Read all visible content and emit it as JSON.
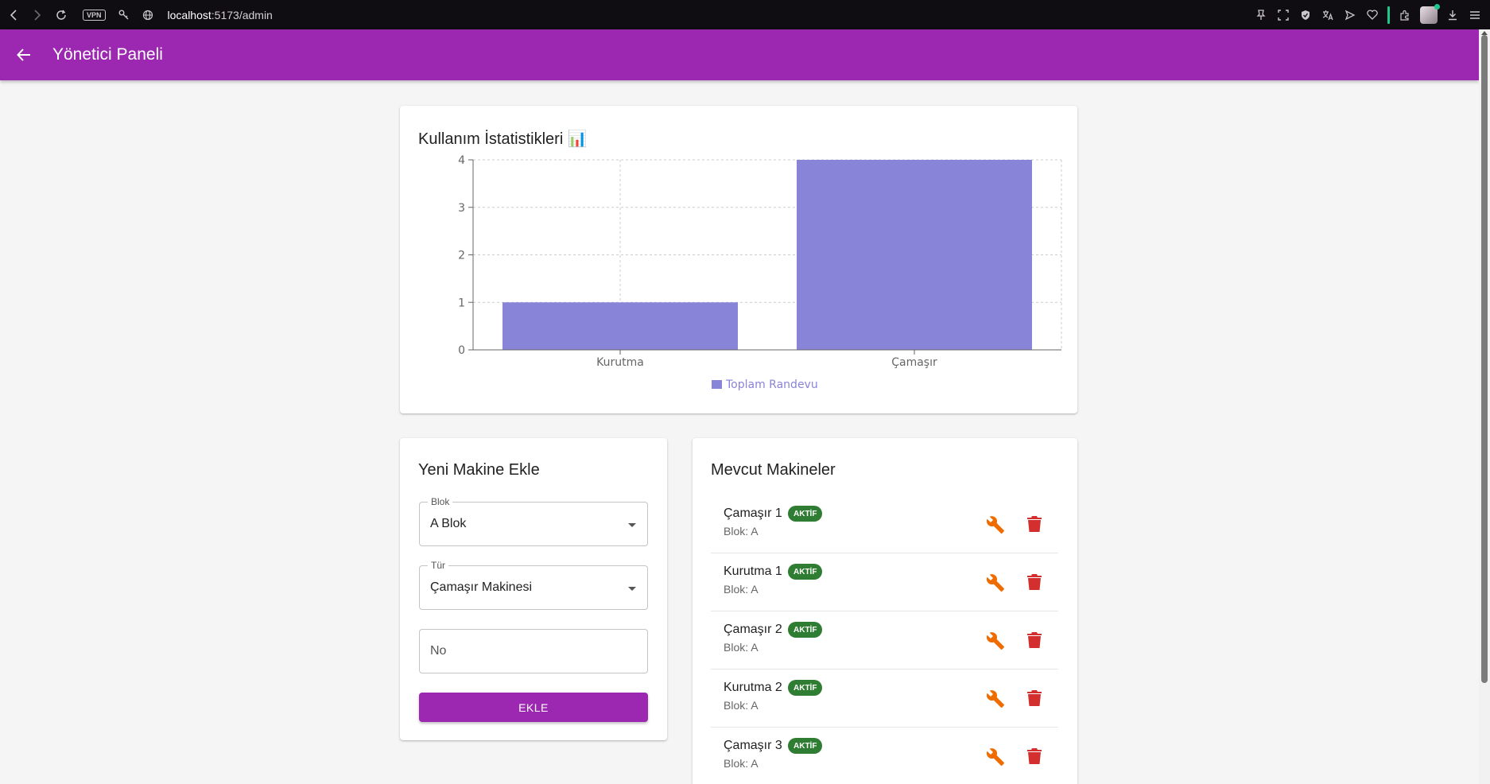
{
  "browser": {
    "url_host": "localhost",
    "url_path": ":5173/admin",
    "vpn": "VPN"
  },
  "app_bar": {
    "title": "Yönetici Paneli"
  },
  "stats": {
    "title": "Kullanım İstatistikleri 📊",
    "chart_data": {
      "type": "bar",
      "categories": [
        "Kurutma",
        "Çamaşır"
      ],
      "series": [
        {
          "name": "Toplam Randevu",
          "values": [
            1,
            4
          ],
          "color": "#8884d8"
        }
      ],
      "ylim": [
        0,
        4
      ],
      "yticks": [
        0,
        1,
        2,
        3,
        4
      ],
      "grid": true,
      "legend": "bottom"
    }
  },
  "form": {
    "title": "Yeni Makine Ekle",
    "block_label": "Blok",
    "block_value": "A Blok",
    "type_label": "Tür",
    "type_value": "Çamaşır Makinesi",
    "no_placeholder": "No",
    "submit_label": "EKLE"
  },
  "machines": {
    "title": "Mevcut Makineler",
    "items": [
      {
        "name": "Çamaşır 1",
        "status": "AKTİF",
        "block": "Blok: A"
      },
      {
        "name": "Kurutma 1",
        "status": "AKTİF",
        "block": "Blok: A"
      },
      {
        "name": "Çamaşır 2",
        "status": "AKTİF",
        "block": "Blok: A"
      },
      {
        "name": "Kurutma 2",
        "status": "AKTİF",
        "block": "Blok: A"
      },
      {
        "name": "Çamaşır 3",
        "status": "AKTİF",
        "block": "Blok: A"
      }
    ]
  },
  "colors": {
    "primary": "#9c27b0",
    "bar": "#8884d8",
    "active_badge": "#2e7d32",
    "wrench": "#ef6c00",
    "trash": "#d32f2f"
  }
}
